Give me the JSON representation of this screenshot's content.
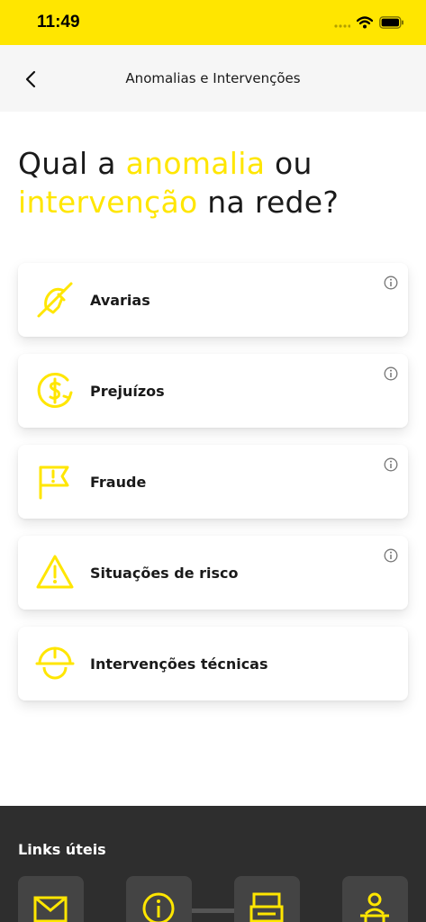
{
  "status_bar": {
    "time": "11:49"
  },
  "nav": {
    "title": "Anomalias e Intervenções"
  },
  "headline": {
    "part1": "Qual a ",
    "highlight1": "anomalia",
    "part2": " ou ",
    "highlight2": "intervenção",
    "part3": " na rede?"
  },
  "cards": [
    {
      "label": "Avarias",
      "icon": "no-signal-hand-icon",
      "has_info": true
    },
    {
      "label": "Prejuízos",
      "icon": "dollar-coin-icon",
      "has_info": true
    },
    {
      "label": "Fraude",
      "icon": "flag-alert-icon",
      "has_info": true
    },
    {
      "label": "Situações de risco",
      "icon": "warning-triangle-icon",
      "has_info": true
    },
    {
      "label": "Intervenções técnicas",
      "icon": "hard-hat-icon",
      "has_info": false
    }
  ],
  "footer": {
    "title": "Links úteis",
    "tiles": [
      "mail-icon",
      "info-icon",
      "printer-icon",
      "desk-person-icon"
    ]
  },
  "colors": {
    "accent": "#FFE600",
    "footer_bg": "#2e2e2e",
    "text": "#1a1a1a"
  }
}
